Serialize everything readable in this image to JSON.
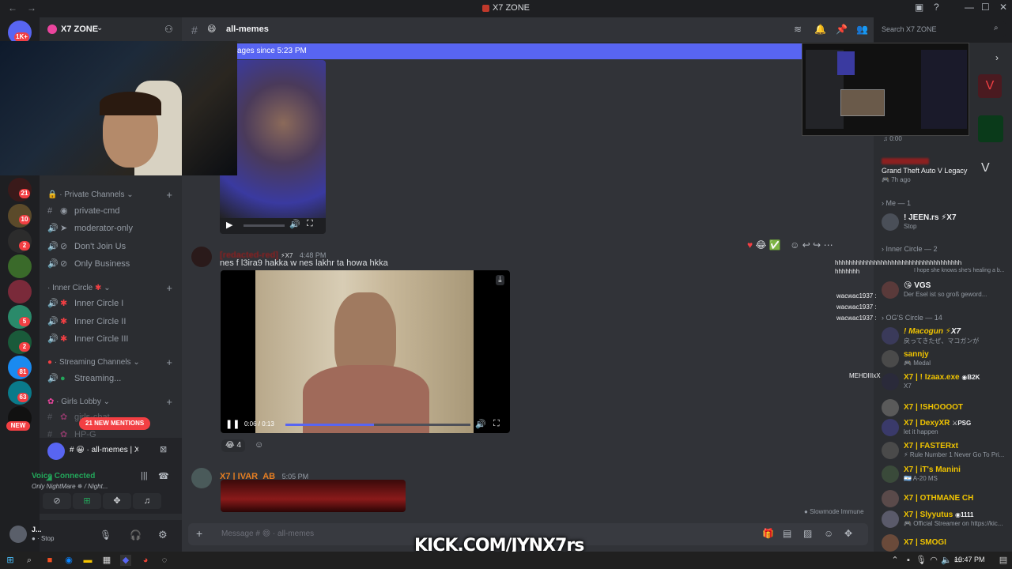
{
  "window": {
    "title": "X7 ZONE",
    "back": "←",
    "forward": "→"
  },
  "rail": {
    "badges": [
      "1K+",
      "21",
      "10",
      "2",
      "5",
      "2",
      "81",
      "63",
      "NEW"
    ]
  },
  "server": {
    "name": "X7 ZONE",
    "categories": [
      {
        "label": "Private Channels",
        "channels": [
          "private-cmd",
          "moderator-only",
          "Don't Join Us",
          "Only Business"
        ]
      },
      {
        "label": "Inner Circle",
        "channels": [
          "Inner Circle I",
          "Inner Circle II",
          "Inner Circle III"
        ]
      },
      {
        "label": "Streaming Channels",
        "channels": [
          "Streaming..."
        ]
      },
      {
        "label": "Girls Lobby",
        "channels": [
          "girls-chat",
          "HP-G"
        ]
      }
    ],
    "mentions_pill": "21 NEW MENTIONS"
  },
  "voice": {
    "channel_preview": "all-memes | X7 ZONE - ...",
    "status": "Voice Connected",
    "server": "Only NightMare",
    "subtitle": "/ Night..."
  },
  "user": {
    "name": "J...",
    "status": "Stop"
  },
  "chat": {
    "channel": "all-memes",
    "search_placeholder": "Search X7 ZONE",
    "new_messages": "ages since 5:23 PM",
    "messages": [
      {
        "author": "[redacted-red] ",
        "time": "4:48 PM",
        "tag": "X7",
        "text": "nes f l3ira9 hakka w nes lakhr ta howa hkka",
        "video_time": "0:06 / 0:13",
        "reaction_count": "4"
      },
      {
        "author": "X7 | IVAR_AB",
        "time": "5:05 PM"
      }
    ],
    "slowmode": "Slowmode Immune",
    "composer_placeholder": "Message #",
    "composer_channel": "all-memes"
  },
  "members": {
    "playing_time": "0:00",
    "game": "Grand Theft Auto V Legacy",
    "game_ago": "7h ago",
    "groups": [
      {
        "label": "Me — 1"
      },
      {
        "label": "Inner Circle — 2"
      },
      {
        "label": "OG'S Circle — 14"
      }
    ],
    "list": [
      {
        "name": "JEEN.rs",
        "tag": "X7",
        "status": "Stop"
      },
      {
        "name": "VGS",
        "status": "Der Esel ist so groß geword..."
      },
      {
        "name": "Macogun",
        "tag": "X7",
        "status": "戻ってきたぜ、マコガンが"
      },
      {
        "name": "sannjy",
        "status": "Medal"
      },
      {
        "name": "X7 | ! Izaax.exe",
        "tag": "B2K",
        "status": "X7"
      },
      {
        "name": "X7 | !SHOOOOT",
        "status": ""
      },
      {
        "name": "X7 | DexyXR",
        "tag": "PSG",
        "status": "let it happen"
      },
      {
        "name": "X7 | FASTERxt",
        "status": "Rule Number 1 Never Go To Pri..."
      },
      {
        "name": "X7 | iT's Manini",
        "status": "A-20 MS"
      },
      {
        "name": "X7 | OTHMANE CH",
        "status": ""
      },
      {
        "name": "X7 | Slyyutus",
        "tag": "1111",
        "status": "Official Streamer on https://kic..."
      },
      {
        "name": "X7 | SMOGI",
        "status": ""
      }
    ]
  },
  "overlay_chat": {
    "line1": "hhhhhhhhhhhhhhhhhhhhhhhhhhhhhhhhhhhh",
    "line2": "hhhhhhh",
    "line3": "I hope she knows she's healing a b...",
    "names": [
      "wacwac1937 :",
      "wacwac1937 :",
      "wacwac1937 :",
      "MEHDIIIxX"
    ]
  },
  "stream_banner": "KICK.COM/JYNX7rs",
  "taskbar": {
    "time": "10:47 PM"
  },
  "colors": {
    "blurple": "#5865f2",
    "red": "#f23f43",
    "gold": "#f0c400",
    "orange": "#e67e22",
    "green": "#23a55a"
  }
}
